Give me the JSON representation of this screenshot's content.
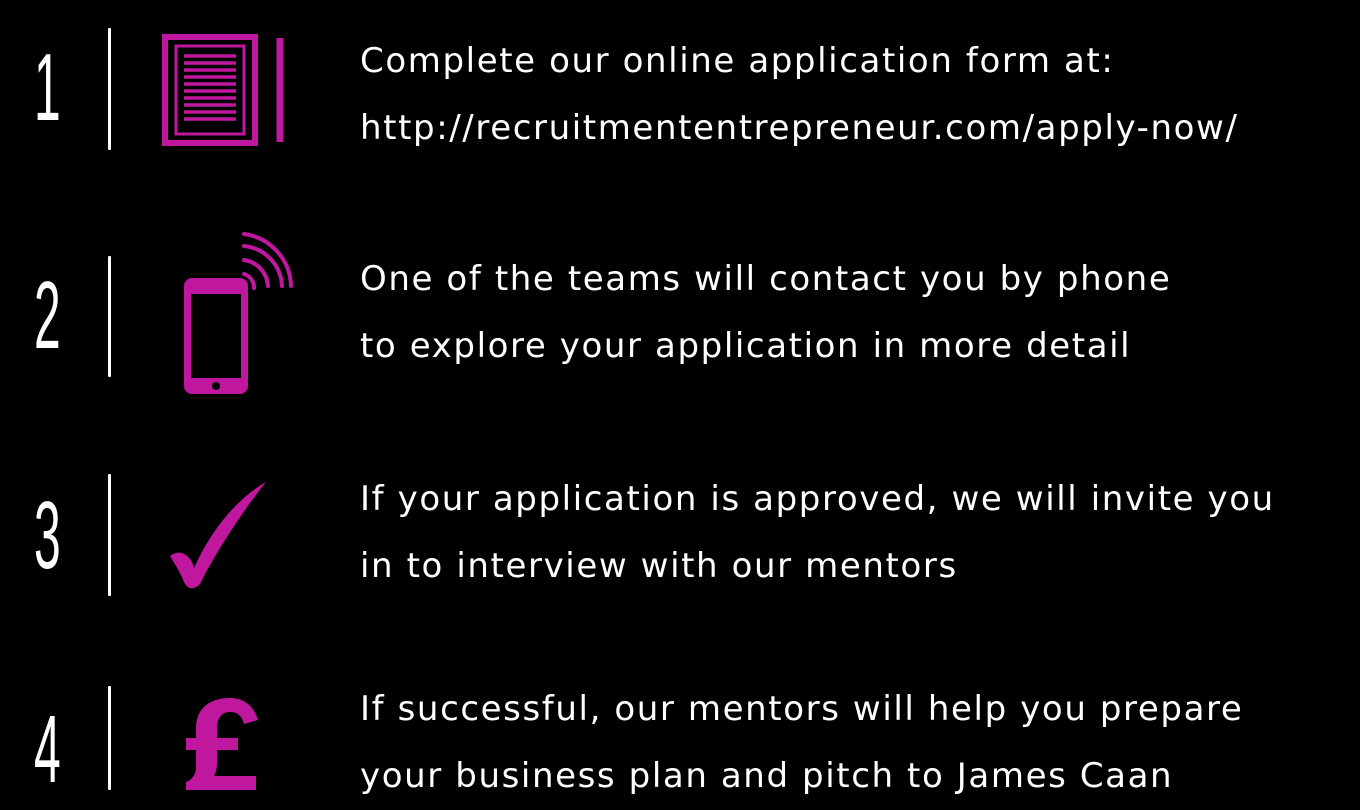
{
  "accent_color": "#c0179f",
  "steps": [
    {
      "number": "1",
      "icon": "document-icon",
      "line1": "Complete our online application form at:",
      "line2": "http://recruitmententrepreneur.com/apply-now/"
    },
    {
      "number": "2",
      "icon": "phone-icon",
      "line1": "One of the teams will contact you by phone",
      "line2": "to explore your application in more detail"
    },
    {
      "number": "3",
      "icon": "checkmark-icon",
      "line1": "If your application is approved, we will invite you",
      "line2": "in to interview with our mentors"
    },
    {
      "number": "4",
      "icon": "pound-sign-icon",
      "line1": "If successful, our mentors will help you prepare",
      "line2": "your business plan and pitch to James Caan"
    }
  ]
}
